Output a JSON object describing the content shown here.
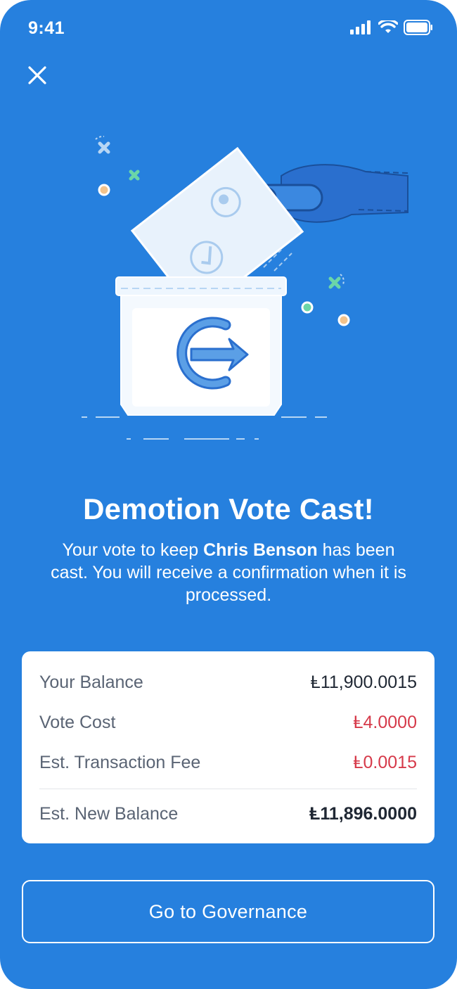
{
  "status_bar": {
    "time": "9:41"
  },
  "header": {
    "close_label": "Close"
  },
  "confirmation": {
    "title": "Demotion Vote Cast!",
    "desc_before": "Your vote to keep ",
    "desc_name": "Chris Benson",
    "desc_after": " has been cast. You will receive a confirmation when it is processed."
  },
  "summary": {
    "rows": [
      {
        "label": "Your Balance",
        "value": "Ⱡ11,900.0015"
      },
      {
        "label": "Vote Cost",
        "value": "Ⱡ4.0000"
      },
      {
        "label": "Est. Transaction Fee",
        "value": "Ⱡ0.0015"
      }
    ],
    "total": {
      "label": "Est. New Balance",
      "value": "Ⱡ11,896.0000"
    }
  },
  "action": {
    "governance_label": "Go to Governance"
  },
  "colors": {
    "background": "#2680DE",
    "negative": "#D63A4A",
    "text_dark": "#1f2733"
  },
  "icons": [
    "signal-icon",
    "wifi-icon",
    "battery-icon",
    "close-icon",
    "ballot-box-illustration"
  ]
}
